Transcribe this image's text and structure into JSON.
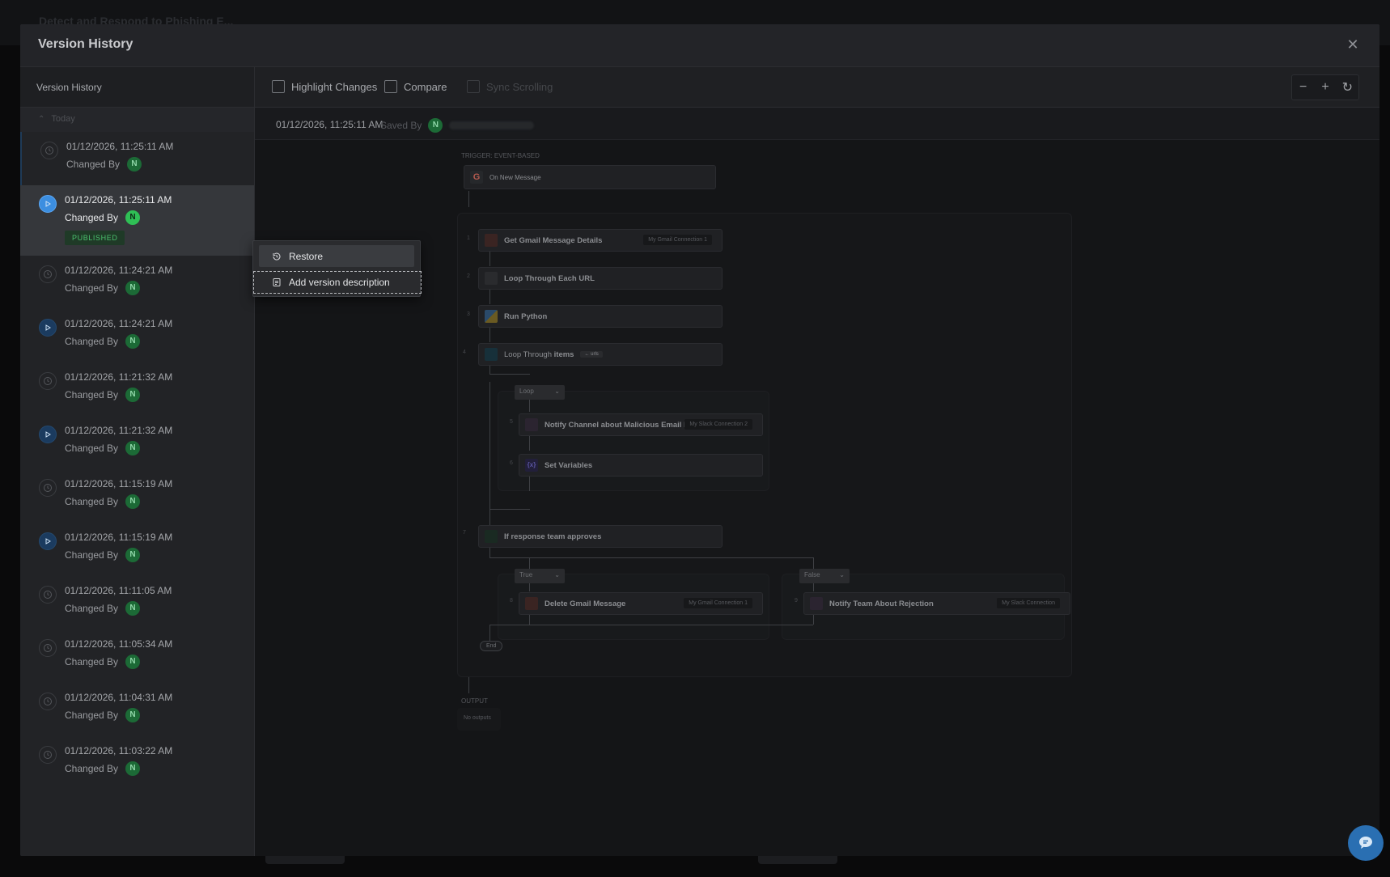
{
  "background": {
    "title": "Detect and Respond to Phishing E..."
  },
  "modal": {
    "title": "Version History"
  },
  "sidebar": {
    "header": "Version History",
    "group_label": "Today",
    "changed_by_label": "Changed By",
    "avatar_initial": "N",
    "published_badge": "PUBLISHED",
    "versions": [
      {
        "date": "01/12/2026, 11:25:11 AM",
        "kind": "draft"
      },
      {
        "date": "01/12/2026, 11:25:11 AM",
        "kind": "published"
      },
      {
        "date": "01/12/2026, 11:24:21 AM",
        "kind": "draft"
      },
      {
        "date": "01/12/2026, 11:24:21 AM",
        "kind": "published"
      },
      {
        "date": "01/12/2026, 11:21:32 AM",
        "kind": "draft"
      },
      {
        "date": "01/12/2026, 11:21:32 AM",
        "kind": "published"
      },
      {
        "date": "01/12/2026, 11:15:19 AM",
        "kind": "draft"
      },
      {
        "date": "01/12/2026, 11:15:19 AM",
        "kind": "published"
      },
      {
        "date": "01/12/2026, 11:11:05 AM",
        "kind": "draft"
      },
      {
        "date": "01/12/2026, 11:05:34 AM",
        "kind": "draft"
      },
      {
        "date": "01/12/2026, 11:04:31 AM",
        "kind": "draft"
      },
      {
        "date": "01/12/2026, 11:03:22 AM",
        "kind": "draft"
      }
    ]
  },
  "toolbar": {
    "highlight_changes": "Highlight Changes",
    "compare": "Compare",
    "sync_scrolling": "Sync Scrolling"
  },
  "info": {
    "timestamp": "01/12/2026, 11:25:11 AM",
    "saved_by_label": "Saved By",
    "avatar_initial": "N"
  },
  "context_menu": {
    "restore": "Restore",
    "add_description": "Add version description"
  },
  "workflow": {
    "trigger_label": "TRIGGER: EVENT-BASED",
    "trigger_node": "On New Message",
    "steps": {
      "s1": {
        "num": "1",
        "label": "Get Gmail Message Details",
        "conn": "My Gmail Connection 1"
      },
      "s2": {
        "num": "2",
        "label": "Loop Through Each URL"
      },
      "s3": {
        "num": "3",
        "label": "Run Python"
      },
      "s4": {
        "num": "4",
        "label_prefix": "Loop Through",
        "label_bold": "items",
        "tag": "← urls"
      },
      "s5": {
        "num": "5",
        "label": "Notify Channel about Malicious Email Findi...",
        "conn": "My Slack Connection 2"
      },
      "s6": {
        "num": "6",
        "label": "Set Variables"
      },
      "s7": {
        "num": "7",
        "label": "If response team approves"
      },
      "s8": {
        "num": "8",
        "label": "Delete Gmail Message",
        "conn": "My Gmail Connection 1"
      },
      "s9": {
        "num": "9",
        "label": "Notify Team About Rejection",
        "conn": "My Slack Connection"
      }
    },
    "loop_dropdown": "Loop",
    "true_dropdown": "True",
    "false_dropdown": "False",
    "end_label": "End",
    "output_label": "OUTPUT",
    "no_outputs": "No outputs"
  },
  "colors": {
    "accent": "#3c8ee0",
    "published": "#4bc06e",
    "avatar": "#2fbf55"
  }
}
